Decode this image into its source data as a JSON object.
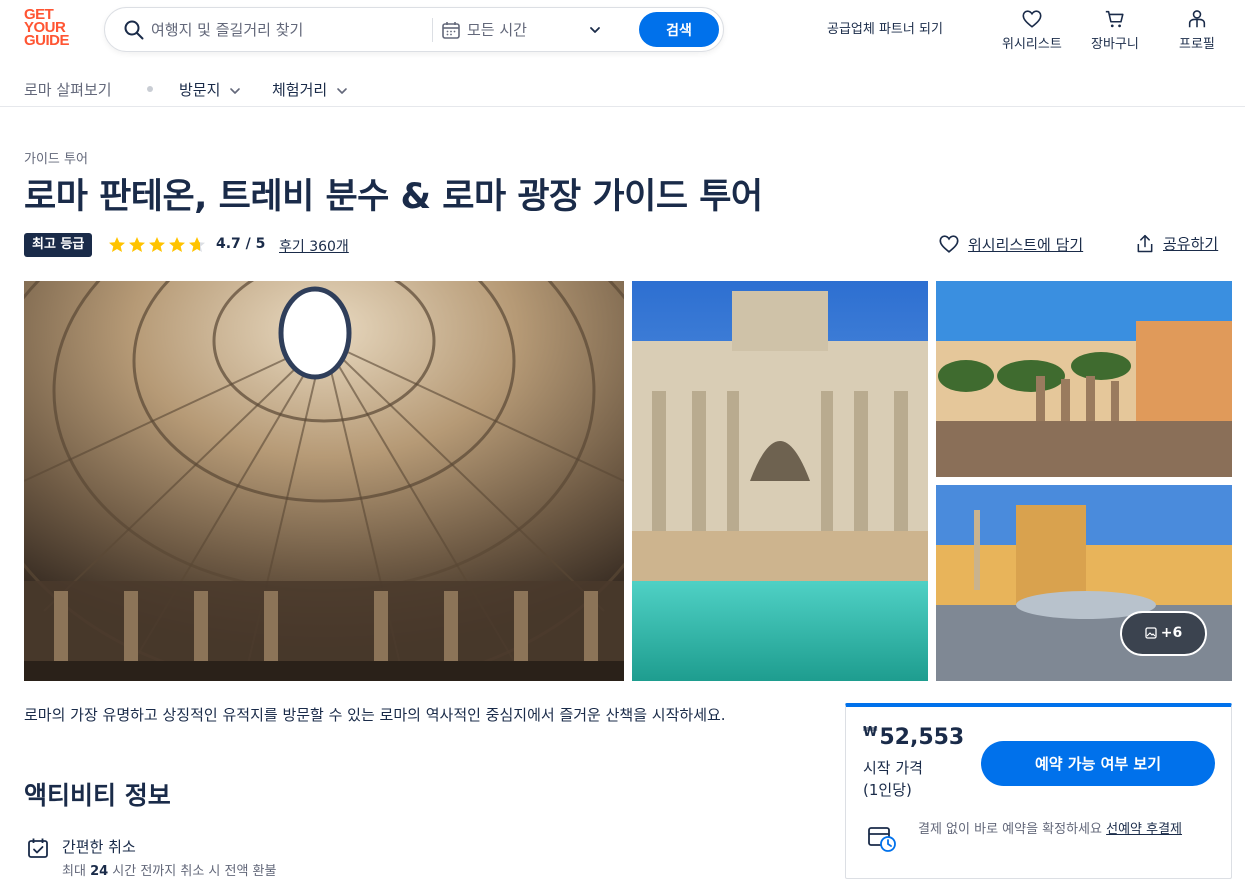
{
  "header": {
    "logo_line1": "GET",
    "logo_line2": "YOUR",
    "logo_line3": "GUIDE",
    "search_placeholder": "여행지 및 즐길거리 찾기",
    "date_label": "모든 시간",
    "search_button": "검색",
    "partner_link": "공급업체 파트너 되기",
    "wishlist": "위시리스트",
    "cart": "장바구니",
    "profile": "프로필"
  },
  "subnav": {
    "explore": "로마 살펴보기",
    "places": "방문지",
    "experiences": "체험거리"
  },
  "activity": {
    "category": "가이드 투어",
    "title": "로마 판테온, 트레비 분수 & 로마 광장 가이드 투어",
    "badge": "최고 등급",
    "rating": "4.7 / 5",
    "rating_value": 4.7,
    "reviews": "후기 360개",
    "wishlist_action": "위시리스트에 담기",
    "share_action": "공유하기",
    "more_photos": "+6",
    "description": "로마의 가장 유명하고 상징적인 유적지를 방문할 수 있는 로마의 역사적인 중심지에서 즐거운 산책을 시작하세요.",
    "section_title": "액티비티 정보",
    "feature_title": "간편한 취소",
    "feature_sub_pre": "최대 ",
    "feature_sub_bold": "24",
    "feature_sub_post": " 시간 전까지 취소 시 전액 환불"
  },
  "booking": {
    "currency": "₩",
    "price": "52,553",
    "price_from": "시작 가격",
    "per_person": "(1인당)",
    "check_button": "예약 가능 여부 보기",
    "reserve_text": "결제 없이 바로 예약을 확정하세요 ",
    "reserve_link": "선예약 후결제"
  },
  "colors": {
    "brand": "#ff5533",
    "primary": "#0071eb",
    "text": "#1a2b49",
    "star": "#ffc300"
  }
}
